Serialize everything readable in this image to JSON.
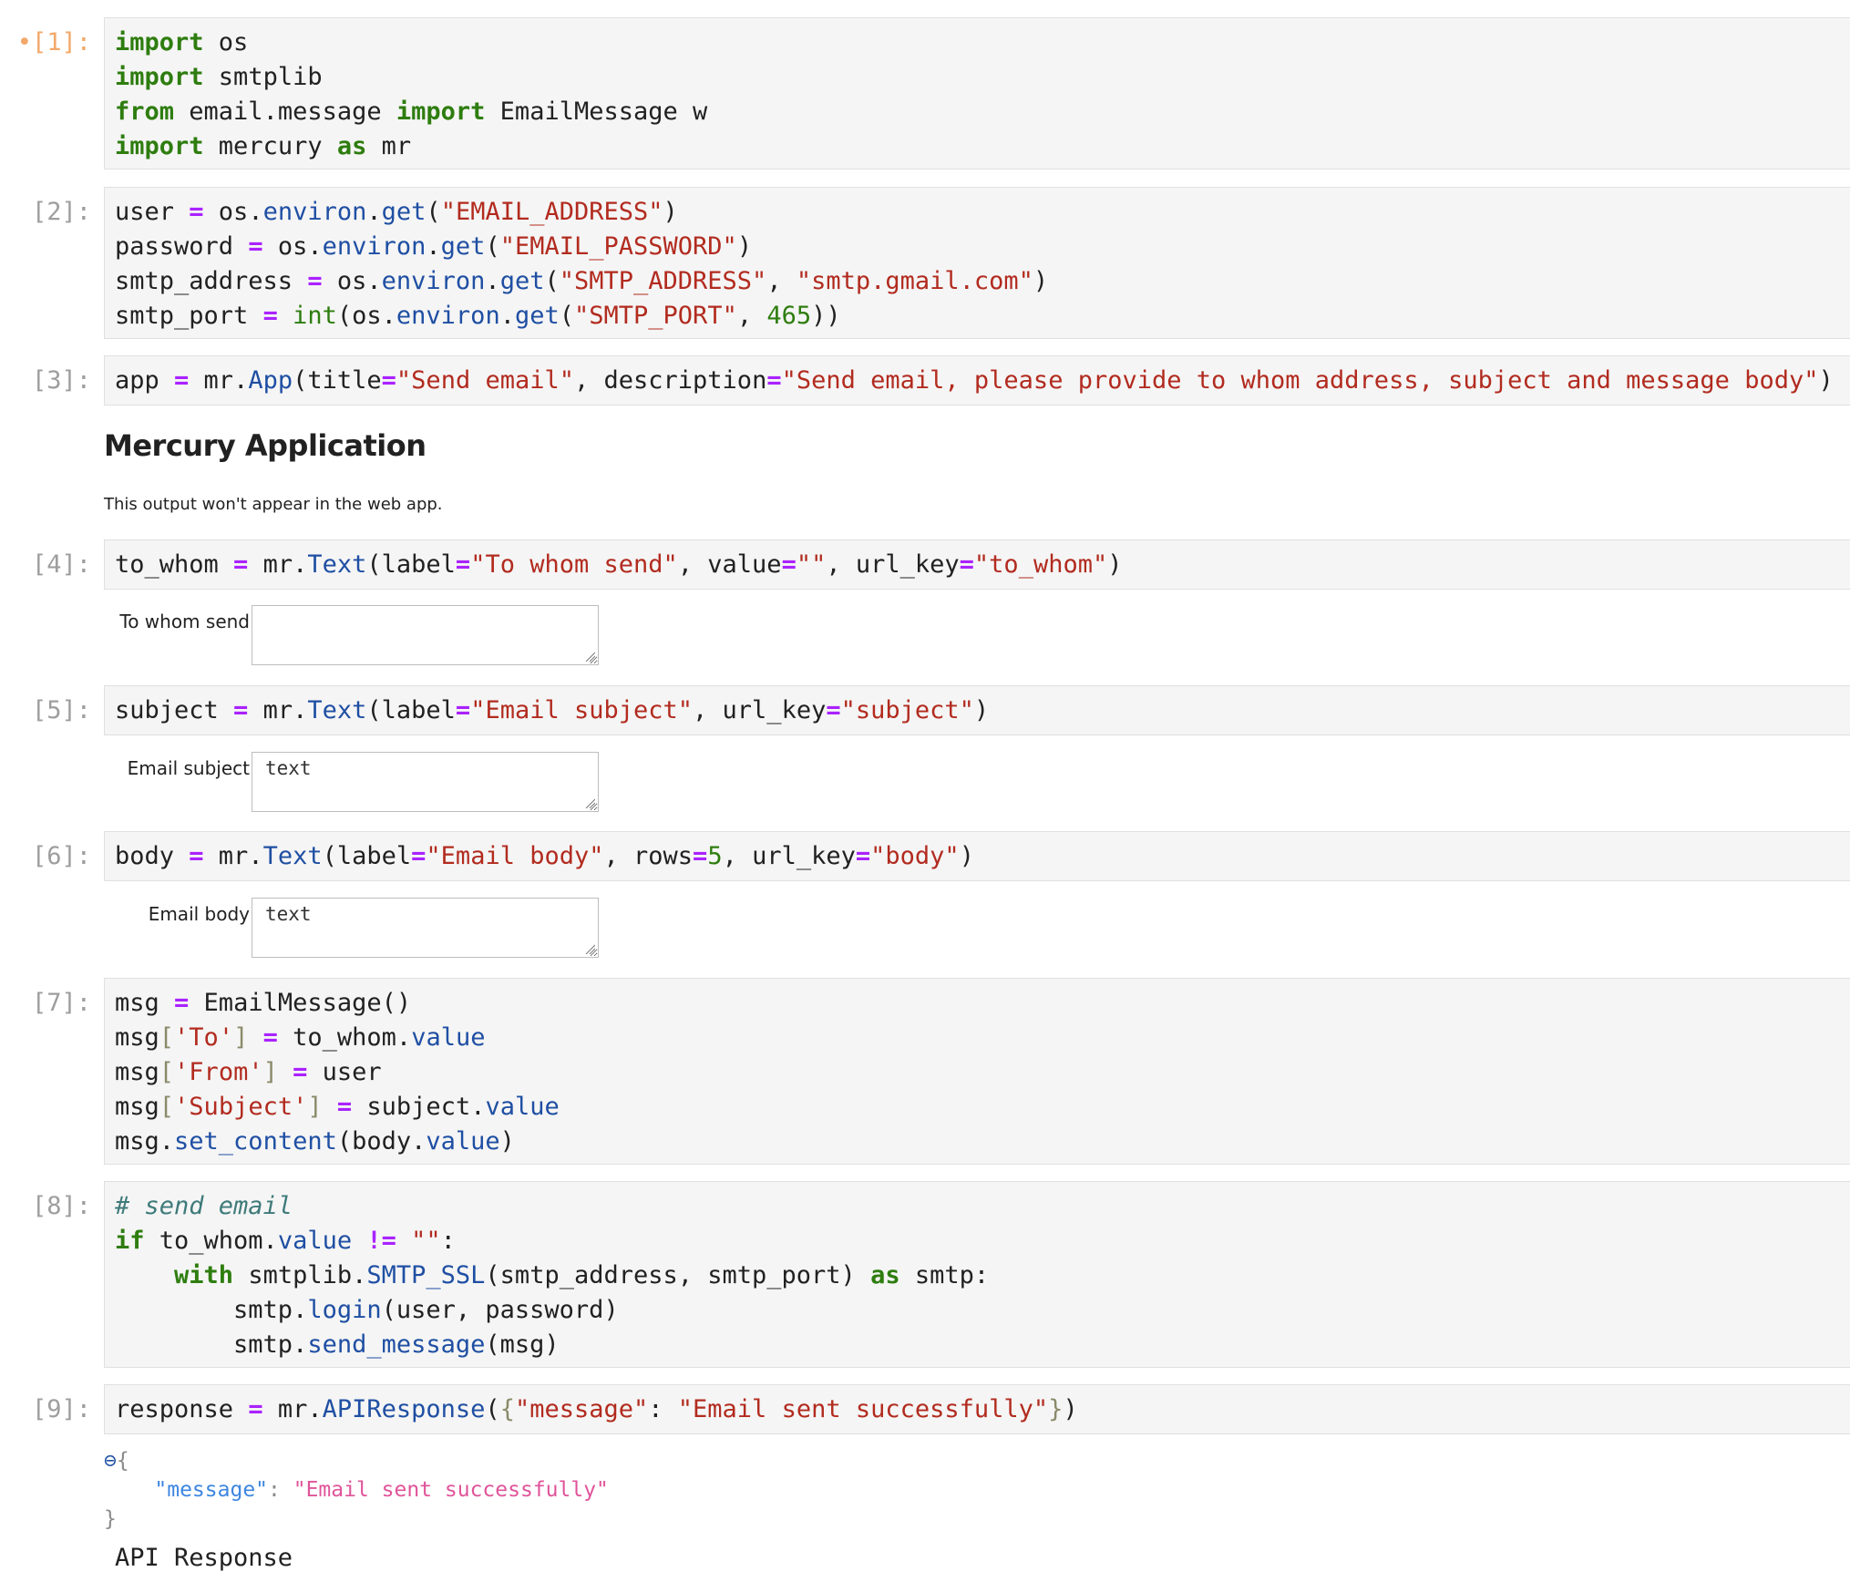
{
  "cells": [
    {
      "prompt": "[1]:",
      "active_marker": "•",
      "lines": [
        [
          {
            "t": "import",
            "c": "kw"
          },
          {
            "t": " os",
            "c": ""
          }
        ],
        [
          {
            "t": "import",
            "c": "kw"
          },
          {
            "t": " smtplib",
            "c": ""
          }
        ],
        [
          {
            "t": "from",
            "c": "kw"
          },
          {
            "t": " email.message ",
            "c": ""
          },
          {
            "t": "import",
            "c": "kw"
          },
          {
            "t": " EmailMessage w",
            "c": ""
          }
        ],
        [
          {
            "t": "import",
            "c": "kw"
          },
          {
            "t": " mercury ",
            "c": ""
          },
          {
            "t": "as",
            "c": "kw"
          },
          {
            "t": " mr",
            "c": ""
          }
        ]
      ]
    },
    {
      "prompt": "[2]:",
      "lines": [
        [
          {
            "t": "user ",
            "c": ""
          },
          {
            "t": "=",
            "c": "op"
          },
          {
            "t": " os.",
            "c": ""
          },
          {
            "t": "environ",
            "c": "attr"
          },
          {
            "t": ".",
            "c": ""
          },
          {
            "t": "get",
            "c": "attr"
          },
          {
            "t": "(",
            "c": ""
          },
          {
            "t": "\"EMAIL_ADDRESS\"",
            "c": "str"
          },
          {
            "t": ")",
            "c": ""
          }
        ],
        [
          {
            "t": "password ",
            "c": ""
          },
          {
            "t": "=",
            "c": "op"
          },
          {
            "t": " os.",
            "c": ""
          },
          {
            "t": "environ",
            "c": "attr"
          },
          {
            "t": ".",
            "c": ""
          },
          {
            "t": "get",
            "c": "attr"
          },
          {
            "t": "(",
            "c": ""
          },
          {
            "t": "\"EMAIL_PASSWORD\"",
            "c": "str"
          },
          {
            "t": ")",
            "c": ""
          }
        ],
        [
          {
            "t": "smtp_address ",
            "c": ""
          },
          {
            "t": "=",
            "c": "op"
          },
          {
            "t": " os.",
            "c": ""
          },
          {
            "t": "environ",
            "c": "attr"
          },
          {
            "t": ".",
            "c": ""
          },
          {
            "t": "get",
            "c": "attr"
          },
          {
            "t": "(",
            "c": ""
          },
          {
            "t": "\"SMTP_ADDRESS\"",
            "c": "str"
          },
          {
            "t": ", ",
            "c": ""
          },
          {
            "t": "\"smtp.gmail.com\"",
            "c": "str"
          },
          {
            "t": ")",
            "c": ""
          }
        ],
        [
          {
            "t": "smtp_port ",
            "c": ""
          },
          {
            "t": "=",
            "c": "op"
          },
          {
            "t": " ",
            "c": ""
          },
          {
            "t": "int",
            "c": "bi"
          },
          {
            "t": "(os.",
            "c": ""
          },
          {
            "t": "environ",
            "c": "attr"
          },
          {
            "t": ".",
            "c": ""
          },
          {
            "t": "get",
            "c": "attr"
          },
          {
            "t": "(",
            "c": ""
          },
          {
            "t": "\"SMTP_PORT\"",
            "c": "str"
          },
          {
            "t": ", ",
            "c": ""
          },
          {
            "t": "465",
            "c": "num"
          },
          {
            "t": "))",
            "c": ""
          }
        ]
      ]
    },
    {
      "prompt": "[3]:",
      "lines": [
        [
          {
            "t": "app ",
            "c": ""
          },
          {
            "t": "=",
            "c": "op"
          },
          {
            "t": " mr.",
            "c": ""
          },
          {
            "t": "App",
            "c": "attr"
          },
          {
            "t": "(title",
            "c": ""
          },
          {
            "t": "=",
            "c": "op"
          },
          {
            "t": "\"Send email\"",
            "c": "str"
          },
          {
            "t": ", description",
            "c": ""
          },
          {
            "t": "=",
            "c": "op"
          },
          {
            "t": "\"Send email, please provide to whom address, subject and message body\"",
            "c": "str"
          },
          {
            "t": ")",
            "c": ""
          }
        ]
      ]
    },
    {
      "prompt": "[4]:",
      "lines": [
        [
          {
            "t": "to_whom ",
            "c": ""
          },
          {
            "t": "=",
            "c": "op"
          },
          {
            "t": " mr.",
            "c": ""
          },
          {
            "t": "Text",
            "c": "attr"
          },
          {
            "t": "(label",
            "c": ""
          },
          {
            "t": "=",
            "c": "op"
          },
          {
            "t": "\"To whom send\"",
            "c": "str"
          },
          {
            "t": ", value",
            "c": ""
          },
          {
            "t": "=",
            "c": "op"
          },
          {
            "t": "\"\"",
            "c": "str"
          },
          {
            "t": ", url_key",
            "c": ""
          },
          {
            "t": "=",
            "c": "op"
          },
          {
            "t": "\"to_whom\"",
            "c": "str"
          },
          {
            "t": ")",
            "c": ""
          }
        ]
      ]
    },
    {
      "prompt": "[5]:",
      "lines": [
        [
          {
            "t": "subject ",
            "c": ""
          },
          {
            "t": "=",
            "c": "op"
          },
          {
            "t": " mr.",
            "c": ""
          },
          {
            "t": "Text",
            "c": "attr"
          },
          {
            "t": "(label",
            "c": ""
          },
          {
            "t": "=",
            "c": "op"
          },
          {
            "t": "\"Email subject\"",
            "c": "str"
          },
          {
            "t": ", url_key",
            "c": ""
          },
          {
            "t": "=",
            "c": "op"
          },
          {
            "t": "\"subject\"",
            "c": "str"
          },
          {
            "t": ")",
            "c": ""
          }
        ]
      ]
    },
    {
      "prompt": "[6]:",
      "lines": [
        [
          {
            "t": "body ",
            "c": ""
          },
          {
            "t": "=",
            "c": "op"
          },
          {
            "t": " mr.",
            "c": ""
          },
          {
            "t": "Text",
            "c": "attr"
          },
          {
            "t": "(label",
            "c": ""
          },
          {
            "t": "=",
            "c": "op"
          },
          {
            "t": "\"Email body\"",
            "c": "str"
          },
          {
            "t": ", rows",
            "c": ""
          },
          {
            "t": "=",
            "c": "op"
          },
          {
            "t": "5",
            "c": "num"
          },
          {
            "t": ", url_key",
            "c": ""
          },
          {
            "t": "=",
            "c": "op"
          },
          {
            "t": "\"body\"",
            "c": "str"
          },
          {
            "t": ")",
            "c": ""
          }
        ]
      ]
    },
    {
      "prompt": "[7]:",
      "lines": [
        [
          {
            "t": "msg ",
            "c": ""
          },
          {
            "t": "=",
            "c": "op"
          },
          {
            "t": " EmailMessage()",
            "c": ""
          }
        ],
        [
          {
            "t": "msg",
            "c": ""
          },
          {
            "t": "[",
            "c": "brk"
          },
          {
            "t": "'To'",
            "c": "str"
          },
          {
            "t": "]",
            "c": "brk"
          },
          {
            "t": " ",
            "c": ""
          },
          {
            "t": "=",
            "c": "op"
          },
          {
            "t": " to_whom.",
            "c": ""
          },
          {
            "t": "value",
            "c": "attr"
          }
        ],
        [
          {
            "t": "msg",
            "c": ""
          },
          {
            "t": "[",
            "c": "brk"
          },
          {
            "t": "'From'",
            "c": "str"
          },
          {
            "t": "]",
            "c": "brk"
          },
          {
            "t": " ",
            "c": ""
          },
          {
            "t": "=",
            "c": "op"
          },
          {
            "t": " user",
            "c": ""
          }
        ],
        [
          {
            "t": "msg",
            "c": ""
          },
          {
            "t": "[",
            "c": "brk"
          },
          {
            "t": "'Subject'",
            "c": "str"
          },
          {
            "t": "]",
            "c": "brk"
          },
          {
            "t": " ",
            "c": ""
          },
          {
            "t": "=",
            "c": "op"
          },
          {
            "t": " subject.",
            "c": ""
          },
          {
            "t": "value",
            "c": "attr"
          }
        ],
        [
          {
            "t": "msg.",
            "c": ""
          },
          {
            "t": "set_content",
            "c": "attr"
          },
          {
            "t": "(body.",
            "c": ""
          },
          {
            "t": "value",
            "c": "attr"
          },
          {
            "t": ")",
            "c": ""
          }
        ]
      ]
    },
    {
      "prompt": "[8]:",
      "lines": [
        [
          {
            "t": "# send email",
            "c": "cmt"
          }
        ],
        [
          {
            "t": "if",
            "c": "kw"
          },
          {
            "t": " to_whom.",
            "c": ""
          },
          {
            "t": "value",
            "c": "attr"
          },
          {
            "t": " ",
            "c": ""
          },
          {
            "t": "!=",
            "c": "op"
          },
          {
            "t": " ",
            "c": ""
          },
          {
            "t": "\"\"",
            "c": "str"
          },
          {
            "t": ":",
            "c": ""
          }
        ],
        [
          {
            "t": "    ",
            "c": ""
          },
          {
            "t": "with",
            "c": "kw"
          },
          {
            "t": " smtplib.",
            "c": ""
          },
          {
            "t": "SMTP_SSL",
            "c": "attr"
          },
          {
            "t": "(smtp_address, smtp_port) ",
            "c": ""
          },
          {
            "t": "as",
            "c": "kw"
          },
          {
            "t": " smtp:",
            "c": ""
          }
        ],
        [
          {
            "t": "        smtp.",
            "c": ""
          },
          {
            "t": "login",
            "c": "attr"
          },
          {
            "t": "(user, password)",
            "c": ""
          }
        ],
        [
          {
            "t": "        smtp.",
            "c": ""
          },
          {
            "t": "send_message",
            "c": "attr"
          },
          {
            "t": "(msg)",
            "c": ""
          }
        ]
      ]
    },
    {
      "prompt": "[9]:",
      "lines": [
        [
          {
            "t": "response ",
            "c": ""
          },
          {
            "t": "=",
            "c": "op"
          },
          {
            "t": " mr.",
            "c": ""
          },
          {
            "t": "APIResponse",
            "c": "attr"
          },
          {
            "t": "(",
            "c": ""
          },
          {
            "t": "{",
            "c": "brk"
          },
          {
            "t": "\"message\"",
            "c": "str"
          },
          {
            "t": ": ",
            "c": ""
          },
          {
            "t": "\"Email sent successfully\"",
            "c": "str"
          },
          {
            "t": "}",
            "c": "brk"
          },
          {
            "t": ")",
            "c": ""
          }
        ]
      ]
    }
  ],
  "app_output": {
    "heading": "Mercury Application",
    "note": "This output won't appear in the web app."
  },
  "widgets": {
    "to_whom": {
      "label": "To whom send",
      "value": "",
      "placeholder": ""
    },
    "subject": {
      "label": "Email subject",
      "value": "text"
    },
    "body": {
      "label": "Email body",
      "value": "text"
    }
  },
  "json_output": {
    "toggle_icon": "collapse-circle-icon",
    "toggle_glyph": "⊖",
    "open_brace": "{",
    "close_brace": "}",
    "key": "\"message\"",
    "colon": ": ",
    "value": "\"Email sent successfully\""
  },
  "api_response_label": "API Response",
  "colors": {
    "keyword": "#2e7d0f",
    "operator": "#aa22ff",
    "string": "#b22b1f",
    "attribute": "#1f4fa3",
    "comment": "#3f7a7a",
    "prompt": "#9e9e9e",
    "active_prompt": "#f2a86a",
    "json_key": "#3d86e0",
    "json_value": "#e0549a"
  }
}
